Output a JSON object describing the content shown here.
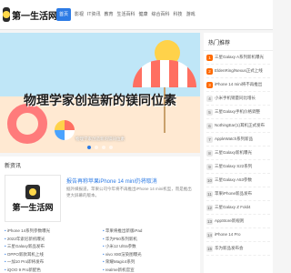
{
  "logo": {
    "text": "第一生活网"
  },
  "nav": [
    {
      "label": "首页",
      "active": true
    },
    {
      "label": "影视",
      "active": false
    },
    {
      "label": "IT资讯",
      "active": false
    },
    {
      "label": "教育",
      "active": false
    },
    {
      "label": "生活百科",
      "active": false
    },
    {
      "label": "健康",
      "active": false
    },
    {
      "label": "综合百科",
      "active": false
    },
    {
      "label": "科技",
      "active": false
    },
    {
      "label": "游戏",
      "active": false
    }
  ],
  "hero": {
    "title": "物理学家创造新的镁同位素",
    "subtitle": "物理学家创造新的镁同位素",
    "slides": 4,
    "current": 1
  },
  "hot": {
    "title": "热门推荐",
    "items": [
      "三星Galaxy A系列新机曝光",
      "EldenRing/Nexus正式上线",
      "iPhone 14 mini将不再推出",
      "小米手机销量同比增长",
      "三星Galaxy手机价格调整",
      "NothingEar(1)耳机正式发布",
      "AppleWatch系列新品",
      "三星Galaxy新机曝光",
      "三星Galaxy S22系列",
      "三星Galaxy A53参数",
      "苹果iPhone新品发布",
      "三星Galaxy Z Fold4",
      "AppStore新规则",
      "iPhone 14 Pro",
      "华为新品发布会"
    ]
  },
  "news": {
    "title": "新资讯",
    "feature": {
      "title": "报告再称苹果iPhone 14 mini仍将取消",
      "desc": "据外媒报道，苹果公司今年将不再推出iPhone 14 mini机型，而是推出更大屏幕的版本。"
    },
    "items": [
      "iPhone 14系列参数曝光",
      "苹果将推出新版iPad",
      "2022年索尼新机曝光",
      "华为P50系列新机",
      "三星Galaxy新品发布",
      "小米12 Ultra参数",
      "OPPO新款耳机上线",
      "vivo X80渲染图曝光",
      "一加10 Pro即将发布",
      "荣耀Magic4系列",
      "iQOO 9 Pro新配色",
      "realme新机官宣"
    ]
  }
}
